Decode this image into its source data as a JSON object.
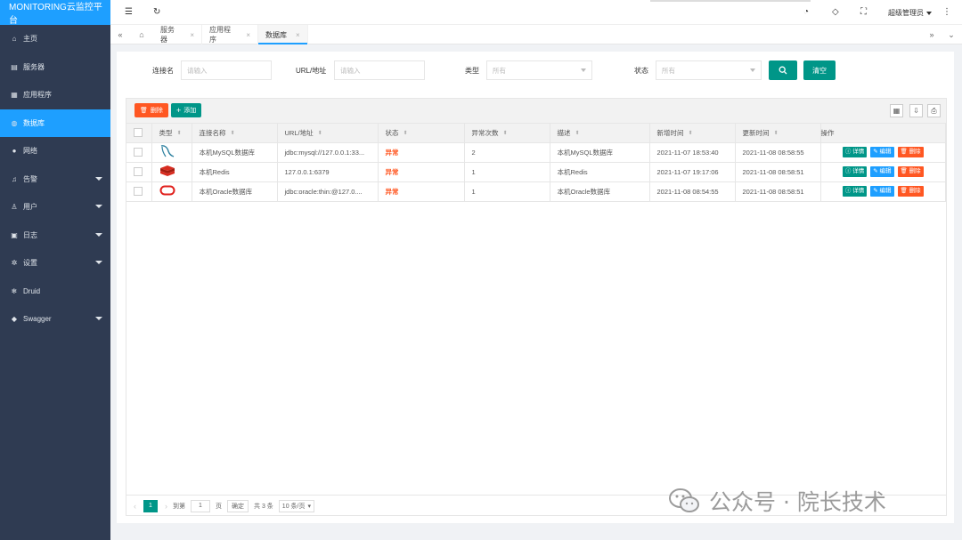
{
  "app": {
    "title": "MONITORING云监控平台"
  },
  "sidebar": {
    "items": [
      {
        "label": "主页",
        "icon": "home-icon",
        "glyph": "⌂",
        "active": false,
        "caret": false
      },
      {
        "label": "服务器",
        "icon": "server-icon",
        "glyph": "▤",
        "active": false,
        "caret": false
      },
      {
        "label": "应用程序",
        "icon": "app-icon",
        "glyph": "▦",
        "active": false,
        "caret": false
      },
      {
        "label": "数据库",
        "icon": "database-icon",
        "glyph": "◍",
        "active": true,
        "caret": false
      },
      {
        "label": "网络",
        "icon": "network-icon",
        "glyph": "●",
        "active": false,
        "caret": false
      },
      {
        "label": "告警",
        "icon": "bell-icon",
        "glyph": "♫",
        "active": false,
        "caret": true
      },
      {
        "label": "用户",
        "icon": "user-icon",
        "glyph": "♙",
        "active": false,
        "caret": true
      },
      {
        "label": "日志",
        "icon": "log-icon",
        "glyph": "▣",
        "active": false,
        "caret": true
      },
      {
        "label": "设置",
        "icon": "gear-icon",
        "glyph": "✲",
        "active": false,
        "caret": true
      },
      {
        "label": "Druid",
        "icon": "snowflake-icon",
        "glyph": "❄",
        "active": false,
        "caret": false
      },
      {
        "label": "Swagger",
        "icon": "swagger-icon",
        "glyph": "◆",
        "active": false,
        "caret": true
      }
    ]
  },
  "header": {
    "user": "超级管理员"
  },
  "tabs": [
    {
      "label": "服务器",
      "active": false
    },
    {
      "label": "应用程序",
      "active": false
    },
    {
      "label": "数据库",
      "active": true
    }
  ],
  "search": {
    "name_label": "连接名",
    "name_placeholder": "请输入",
    "url_label": "URL/地址",
    "url_placeholder": "请输入",
    "type_label": "类型",
    "type_value": "所有",
    "status_label": "状态",
    "status_value": "所有",
    "clear_label": "清空"
  },
  "toolbar": {
    "delete_label": "删除",
    "add_label": "添加"
  },
  "table": {
    "headers": [
      "类型",
      "连接名称",
      "URL/地址",
      "状态",
      "异常次数",
      "描述",
      "新增时间",
      "更新时间",
      "操作"
    ],
    "rows": [
      {
        "type_icon": "mysql-icon",
        "name": "本机MySQL数据库",
        "url": "jdbc:mysql://127.0.0.1:33...",
        "status": "异常",
        "count": "2",
        "desc": "本机MySQL数据库",
        "created": "2021-11-07 18:53:40",
        "updated": "2021-11-08 08:58:55"
      },
      {
        "type_icon": "redis-icon",
        "name": "本机Redis",
        "url": "127.0.0.1:6379",
        "status": "异常",
        "count": "1",
        "desc": "本机Redis",
        "created": "2021-11-07 19:17:06",
        "updated": "2021-11-08 08:58:51"
      },
      {
        "type_icon": "oracle-icon",
        "name": "本机Oracle数据库",
        "url": "jdbc:oracle:thin:@127.0....",
        "status": "异常",
        "count": "1",
        "desc": "本机Oracle数据库",
        "created": "2021-11-08 08:54:55",
        "updated": "2021-11-08 08:58:51"
      }
    ],
    "ops": {
      "detail": "详情",
      "edit": "编辑",
      "delete": "删除"
    }
  },
  "pager": {
    "current": "1",
    "goto_label": "到第",
    "goto_value": "1",
    "page_label": "页",
    "confirm_label": "确定",
    "total_label": "共 3 条",
    "size_label": "10 条/页"
  },
  "watermark": {
    "text": "公众号 · 院长技术"
  },
  "colors": {
    "primary": "#1e9fff",
    "green": "#009688",
    "danger": "#ff5722",
    "sidebar": "#2f3b52"
  }
}
